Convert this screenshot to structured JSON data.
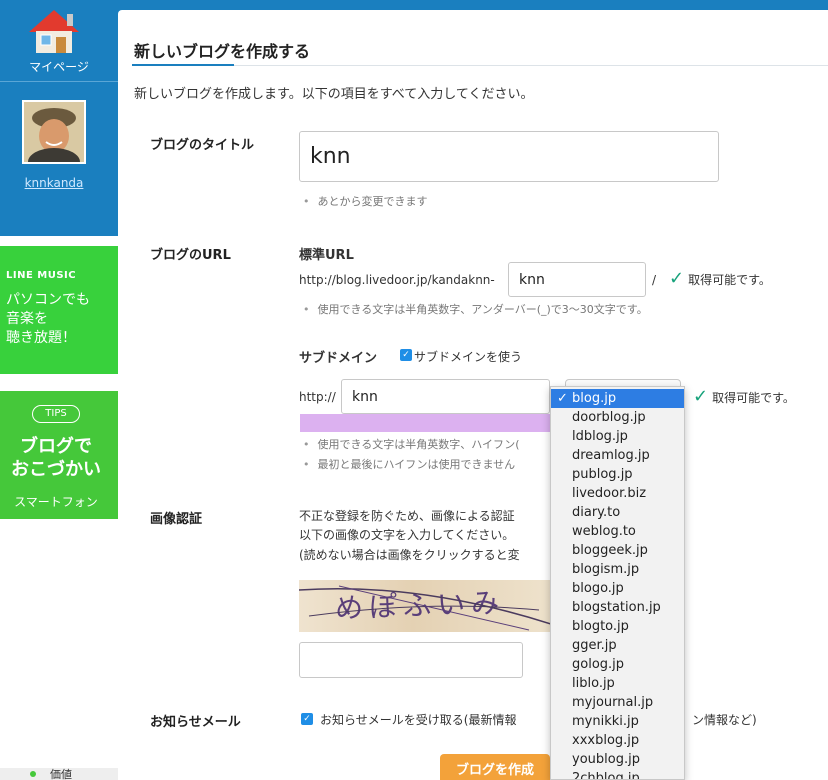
{
  "sidebar": {
    "mypage_label": "マイページ",
    "username": "knnkanda",
    "music_banner": {
      "brand": "LINE MUSIC",
      "line1": "パソコンでも",
      "line2": "音楽を",
      "line3": "聴き放題！"
    },
    "tips_banner": {
      "badge": "TIPS",
      "title1": "ブログで",
      "title2": "おこづかい",
      "sub": "スマートフォン"
    },
    "bottom_text": "価値"
  },
  "page": {
    "title": "新しいブログを作成する",
    "intro": "新しいブログを作成します。以下の項目をすべて入力してください。"
  },
  "form": {
    "blog_title": {
      "label": "ブログのタイトル",
      "value": "knn",
      "note": "あとから変更できます"
    },
    "blog_url": {
      "label": "ブログのURL",
      "standard_heading": "標準URL",
      "prefix": "http://blog.livedoor.jp/kandaknn-",
      "value": "knn",
      "slash": "/",
      "status": "取得可能です。",
      "note": "使用できる文字は半角英数字、アンダーバー(_)で3〜30文字です。"
    },
    "subdomain": {
      "heading": "サブドメイン",
      "checkbox_label": "サブドメインを使う",
      "prefix": "http://",
      "value": "knn",
      "status": "取得可能です。",
      "note1": "使用できる文字は半角英数字、ハイフン(",
      "note2": "最初と最後にハイフンは使用できません"
    },
    "captcha": {
      "label": "画像認証",
      "line1": "不正な登録を防ぐため、画像による認証",
      "line2": "以下の画像の文字を入力してください。",
      "line3": "(読めない場合は画像をクリックすると変",
      "image_text": "めぽふいみ",
      "value": ""
    },
    "notify": {
      "label": "お知らせメール",
      "checkbox_label": "お知らせメールを受け取る(最新情報",
      "tail": "ン情報など)"
    },
    "submit_label": "ブログを作成"
  },
  "domain_dropdown": {
    "selected": "blog.jp",
    "options": [
      "blog.jp",
      "doorblog.jp",
      "ldblog.jp",
      "dreamlog.jp",
      "publog.jp",
      "livedoor.biz",
      "diary.to",
      "weblog.to",
      "bloggeek.jp",
      "blogism.jp",
      "blogo.jp",
      "blogstation.jp",
      "blogto.jp",
      "gger.jp",
      "golog.jp",
      "liblo.jp",
      "myjournal.jp",
      "mynikki.jp",
      "xxxblog.jp",
      "youblog.jp",
      "2chblog.jp"
    ]
  },
  "colors": {
    "brand_blue": "#1a7fbf",
    "ok_green": "#17a27b",
    "line_music_green": "#38d13c",
    "submit_orange": "#f3a23a",
    "dropdown_highlight": "#2d7de3"
  }
}
